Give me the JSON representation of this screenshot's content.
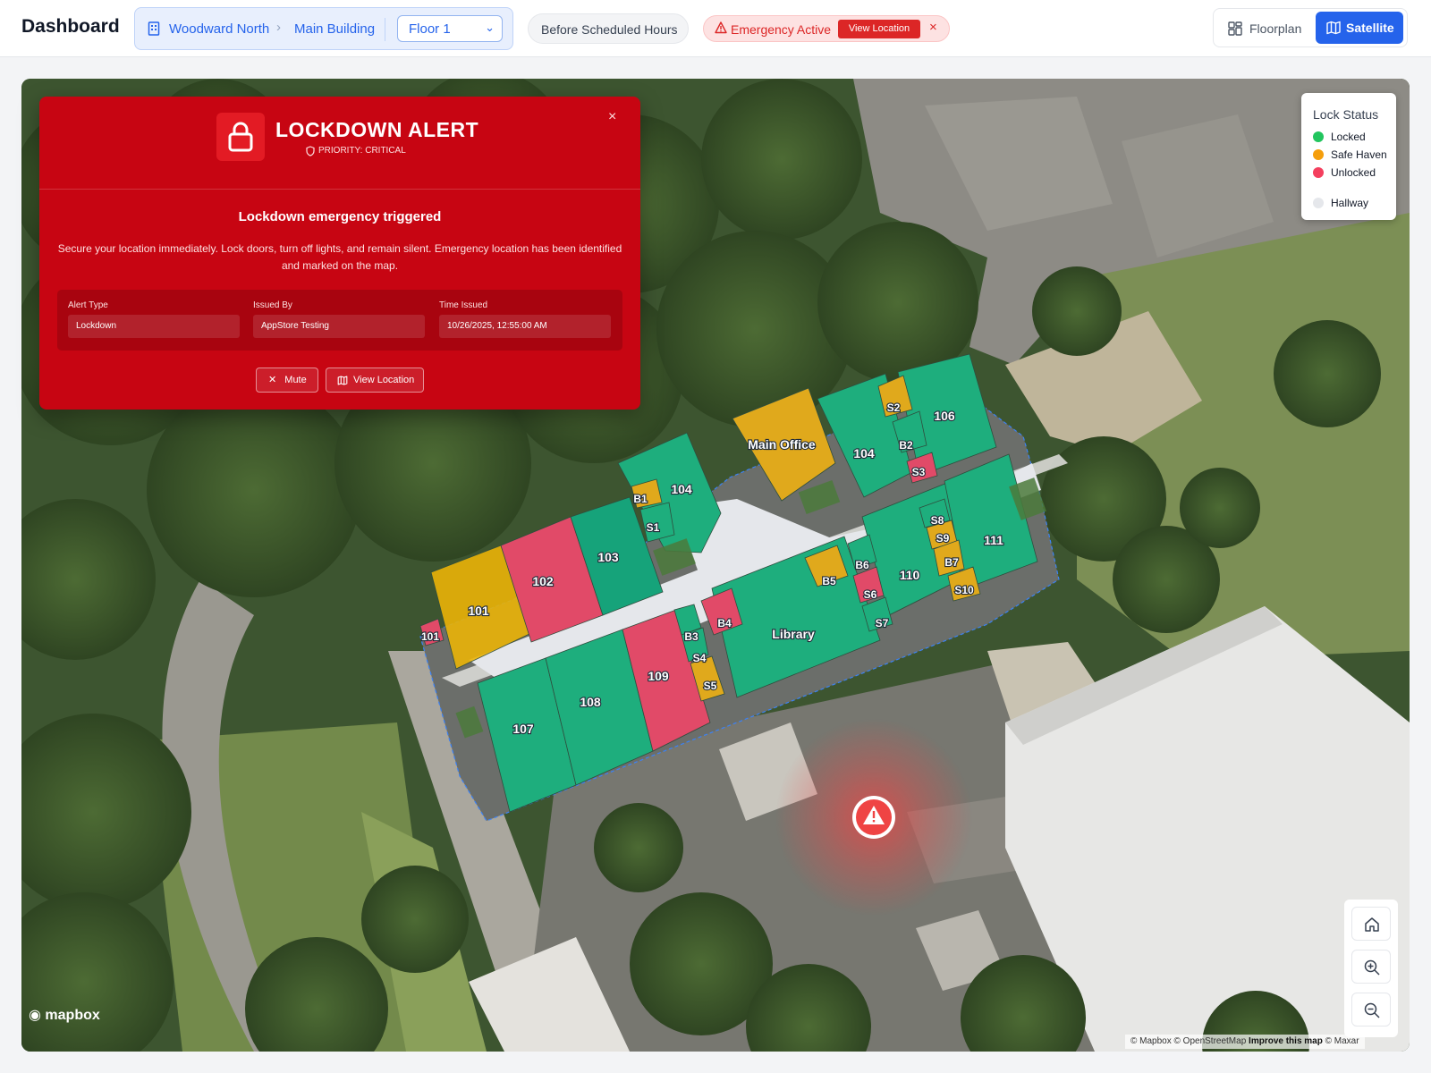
{
  "header": {
    "title": "Dashboard",
    "breadcrumb": {
      "location": "Woodward North",
      "building": "Main Building",
      "floor": "Floor 1"
    },
    "schedule_status": "Before Scheduled Hours",
    "emergency": {
      "label": "Emergency Active",
      "button": "View Location",
      "close": "×"
    },
    "view_toggle": {
      "floorplan": "Floorplan",
      "satellite": "Satellite",
      "active": "Satellite"
    }
  },
  "alert": {
    "title": "LOCKDOWN ALERT",
    "priority": "PRIORITY: CRITICAL",
    "close": "×",
    "heading": "Lockdown emergency triggered",
    "description": "Secure your location immediately. Lock doors, turn off lights, and remain silent. Emergency location has been identified and marked on the map.",
    "fields": [
      {
        "label": "Alert Type",
        "value": "Lockdown"
      },
      {
        "label": "Issued By",
        "value": "AppStore Testing"
      },
      {
        "label": "Time Issued",
        "value": "10/26/2025, 12:55:00 AM"
      }
    ],
    "buttons": {
      "mute": "Mute",
      "view_location": "View Location"
    }
  },
  "legend": {
    "title": "Lock Status",
    "items": [
      {
        "label": "Locked",
        "color": "#22c55e"
      },
      {
        "label": "Safe Haven",
        "color": "#f59e0b"
      },
      {
        "label": "Unlocked",
        "color": "#f43f5e"
      },
      {
        "label": "Hallway",
        "color": "#e5e7eb"
      }
    ]
  },
  "rooms": [
    {
      "label": "101",
      "status": "Safe Haven"
    },
    {
      "label": "102",
      "status": "Unlocked"
    },
    {
      "label": "103",
      "status": "Locked"
    },
    {
      "label": "104",
      "status": "Locked"
    },
    {
      "label": "Main Office",
      "status": "Safe Haven"
    },
    {
      "label": "104",
      "status": "Locked"
    },
    {
      "label": "106",
      "status": "Locked"
    },
    {
      "label": "S2",
      "status": "Safe Haven"
    },
    {
      "label": "B2",
      "status": "Locked"
    },
    {
      "label": "S3",
      "status": "Unlocked"
    },
    {
      "label": "B1",
      "status": "Safe Haven"
    },
    {
      "label": "S1",
      "status": "Locked"
    },
    {
      "label": "107",
      "status": "Locked"
    },
    {
      "label": "108",
      "status": "Locked"
    },
    {
      "label": "109",
      "status": "Unlocked"
    },
    {
      "label": "Library",
      "status": "Locked"
    },
    {
      "label": "110",
      "status": "Locked"
    },
    {
      "label": "111",
      "status": "Locked"
    },
    {
      "label": "B3",
      "status": "Locked"
    },
    {
      "label": "S4",
      "status": "Locked"
    },
    {
      "label": "S5",
      "status": "Safe Haven"
    },
    {
      "label": "B4",
      "status": "Unlocked"
    },
    {
      "label": "B5",
      "status": "Safe Haven"
    },
    {
      "label": "B6",
      "status": "Locked"
    },
    {
      "label": "S6",
      "status": "Unlocked"
    },
    {
      "label": "S7",
      "status": "Locked"
    },
    {
      "label": "S8",
      "status": "Locked"
    },
    {
      "label": "S9",
      "status": "Safe Haven"
    },
    {
      "label": "B7",
      "status": "Safe Haven"
    },
    {
      "label": "S10",
      "status": "Safe Haven"
    },
    {
      "label": "101",
      "status": "Unlocked"
    }
  ],
  "map": {
    "attribution": {
      "mapbox": "© Mapbox",
      "osm": "© OpenStreetMap",
      "improve": "Improve this map",
      "maxar": "© Maxar"
    },
    "logo": "mapbox"
  },
  "icons": [
    "building-icon",
    "chevron-right-icon",
    "chevron-down-icon",
    "warning-icon",
    "close-icon",
    "grid-icon",
    "map-icon",
    "lock-icon",
    "shield-icon",
    "home-icon",
    "zoom-in-icon",
    "zoom-out-icon",
    "emergency-marker-icon"
  ]
}
